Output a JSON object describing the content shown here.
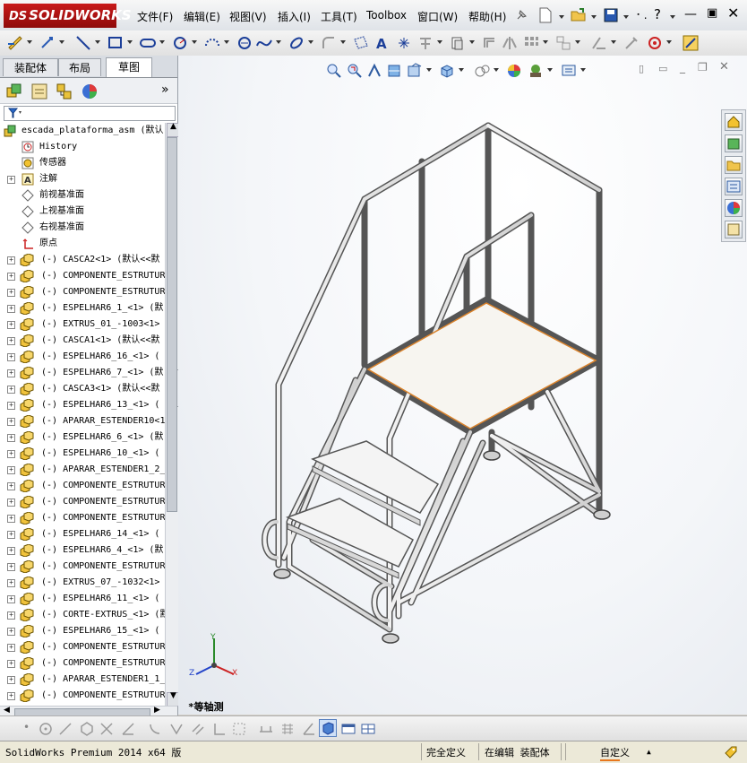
{
  "app": {
    "logo_text": "SOLIDWORKS",
    "logo_mark": "DS"
  },
  "menu": [
    {
      "label": "文件(F)"
    },
    {
      "label": "编辑(E)"
    },
    {
      "label": "视图(V)"
    },
    {
      "label": "插入(I)"
    },
    {
      "label": "工具(T)"
    },
    {
      "label": "Toolbox"
    },
    {
      "label": "窗口(W)"
    },
    {
      "label": "帮助(H)"
    }
  ],
  "panel_tabs": [
    {
      "label": "装配体",
      "active": false
    },
    {
      "label": "布局",
      "active": false
    },
    {
      "label": "草图",
      "active": true
    }
  ],
  "tree": {
    "root": "escada_plataforma_asm (默认",
    "items": [
      {
        "label": "History",
        "icon": "history-icon",
        "expander": false
      },
      {
        "label": "传感器",
        "icon": "sensor-icon",
        "expander": false
      },
      {
        "label": "注解",
        "icon": "annotation-icon",
        "expander": true
      },
      {
        "label": "前视基准面",
        "icon": "plane-icon",
        "expander": false
      },
      {
        "label": "上视基准面",
        "icon": "plane-icon",
        "expander": false
      },
      {
        "label": "右视基准面",
        "icon": "plane-icon",
        "expander": false
      },
      {
        "label": "原点",
        "icon": "origin-icon",
        "expander": false
      },
      {
        "label": "(-) CASCA2<1> (默认<<默",
        "icon": "part-icon",
        "expander": true
      },
      {
        "label": "(-) COMPONENTE_ESTRUTUR",
        "icon": "part-icon",
        "expander": true
      },
      {
        "label": "(-) COMPONENTE_ESTRUTUR",
        "icon": "part-icon",
        "expander": true
      },
      {
        "label": "(-) ESPELHAR6_1_<1> (默",
        "icon": "part-icon",
        "expander": true
      },
      {
        "label": "(-) EXTRUS_01_-1003<1>",
        "icon": "part-icon",
        "expander": true
      },
      {
        "label": "(-) CASCA1<1> (默认<<默",
        "icon": "part-icon",
        "expander": true
      },
      {
        "label": "(-) ESPELHAR6_16_<1> (",
        "icon": "part-icon",
        "expander": true
      },
      {
        "label": "(-) ESPELHAR6_7_<1> (默",
        "icon": "part-icon",
        "expander": true
      },
      {
        "label": "(-) CASCA3<1> (默认<<默",
        "icon": "part-icon",
        "expander": true
      },
      {
        "label": "(-) ESPELHAR6_13_<1> (",
        "icon": "part-icon",
        "expander": true
      },
      {
        "label": "(-) APARAR_ESTENDER10<1",
        "icon": "part-icon",
        "expander": true
      },
      {
        "label": "(-) ESPELHAR6_6_<1> (默",
        "icon": "part-icon",
        "expander": true
      },
      {
        "label": "(-) ESPELHAR6_10_<1> (",
        "icon": "part-icon",
        "expander": true
      },
      {
        "label": "(-) APARAR_ESTENDER1_2_",
        "icon": "part-icon",
        "expander": true
      },
      {
        "label": "(-) COMPONENTE_ESTRUTUR",
        "icon": "part-icon",
        "expander": true
      },
      {
        "label": "(-) COMPONENTE_ESTRUTUR",
        "icon": "part-icon",
        "expander": true
      },
      {
        "label": "(-) COMPONENTE_ESTRUTUR",
        "icon": "part-icon",
        "expander": true
      },
      {
        "label": "(-) ESPELHAR6_14_<1> (",
        "icon": "part-icon",
        "expander": true
      },
      {
        "label": "(-) ESPELHAR6_4_<1> (默",
        "icon": "part-icon",
        "expander": true
      },
      {
        "label": "(-) COMPONENTE_ESTRUTUR",
        "icon": "part-icon",
        "expander": true
      },
      {
        "label": "(-) EXTRUS_07_-1032<1>",
        "icon": "part-icon",
        "expander": true
      },
      {
        "label": "(-) ESPELHAR6_11_<1> (",
        "icon": "part-icon",
        "expander": true
      },
      {
        "label": "(-) CORTE-EXTRUS_<1> (默",
        "icon": "part-icon",
        "expander": true
      },
      {
        "label": "(-) ESPELHAR6_15_<1> (",
        "icon": "part-icon",
        "expander": true
      },
      {
        "label": "(-) COMPONENTE_ESTRUTUR",
        "icon": "part-icon",
        "expander": true
      },
      {
        "label": "(-) COMPONENTE_ESTRUTUR",
        "icon": "part-icon",
        "expander": true
      },
      {
        "label": "(-) APARAR_ESTENDER1_1_",
        "icon": "part-icon",
        "expander": true
      },
      {
        "label": "(-) COMPONENTE_ESTRUTUR",
        "icon": "part-icon",
        "expander": true
      }
    ]
  },
  "triad": {
    "x": "X",
    "y": "Y",
    "z": "Z"
  },
  "view_label": "*等轴测",
  "status": {
    "product": "SolidWorks Premium 2014 x64 版",
    "definition": "完全定义",
    "mode": "在编辑 装配体",
    "units": "自定义",
    "units_arrow": "▲"
  },
  "colors": {
    "accent_red": "#b31515",
    "tube_stroke": "#555555",
    "platform_edge": "#d9822b"
  }
}
